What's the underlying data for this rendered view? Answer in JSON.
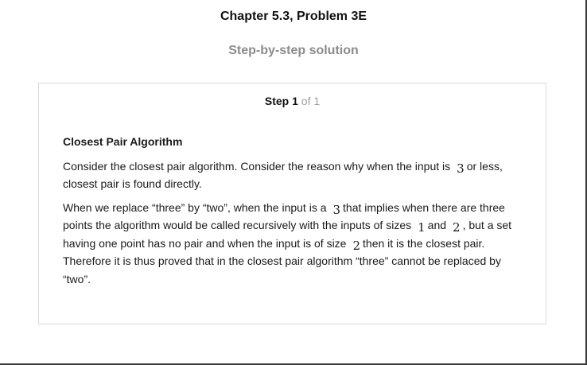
{
  "header": {
    "chapter_title": "Chapter 5.3, Problem 3E",
    "solution_label": "Step-by-step solution"
  },
  "step": {
    "label": "Step",
    "number": "1",
    "of_total": "of 1"
  },
  "content": {
    "heading": "Closest Pair Algorithm",
    "p1": {
      "t1": "Consider the closest pair algorithm. Consider the reason why when the input is",
      "m1": "3",
      "t2": "or less, closest pair is found directly."
    },
    "p2": {
      "t1": "When we replace “three” by “two”, when the input is a",
      "m1": "3",
      "t2": "that implies when there are three points the algorithm would be called recursively with the inputs of sizes",
      "m2": "1",
      "t3": "and",
      "m3": "2",
      "t4": ", but a set having one point has no pair and when the input is of size",
      "m4": "2",
      "t5": "then it is the closest pair. Therefore it is thus proved that in the closest pair algorithm “three” cannot be replaced by “two”."
    }
  }
}
